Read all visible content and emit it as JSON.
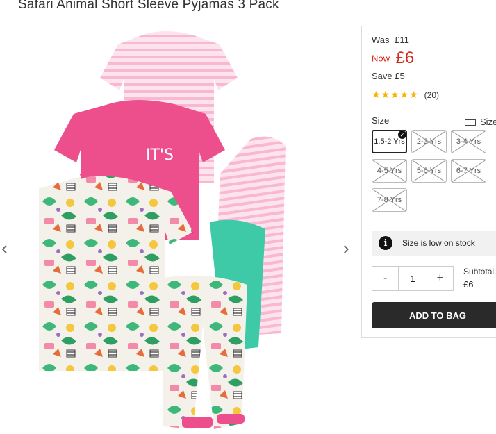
{
  "product": {
    "title": "Safari Animal Short Sleeve Pyjamas 3 Pack"
  },
  "gallery": {
    "prev_icon": "‹",
    "next_icon": "›"
  },
  "pricing": {
    "was_label": "Was",
    "was_price": "£11",
    "now_label": "Now",
    "now_price": "£6",
    "save_label": "Save",
    "save_amount": "£5",
    "now_color": "#d42a1e"
  },
  "rating": {
    "stars": "★★★★★",
    "count": "(20)",
    "star_color": "#f5b400"
  },
  "size": {
    "label": "Size",
    "guide_label": "Size",
    "options": [
      {
        "label": "1.5-2 Yrs",
        "state": "selected"
      },
      {
        "label": "2-3 Yrs",
        "state": "out-of-stock"
      },
      {
        "label": "3-4 Yrs",
        "state": "out-of-stock"
      },
      {
        "label": "4-5 Yrs",
        "state": "out-of-stock"
      },
      {
        "label": "5-6 Yrs",
        "state": "out-of-stock"
      },
      {
        "label": "6-7 Yrs",
        "state": "out-of-stock"
      },
      {
        "label": "7-8 Yrs",
        "state": "out-of-stock"
      }
    ]
  },
  "stock": {
    "icon": "i",
    "text": "Size is low on stock"
  },
  "quantity": {
    "minus": "-",
    "value": "1",
    "plus": "+"
  },
  "subtotal": {
    "label": "Subtotal",
    "value": "£6"
  },
  "cta": {
    "add_to_bag": "ADD TO BAG",
    "color": "#2a2a2a"
  }
}
